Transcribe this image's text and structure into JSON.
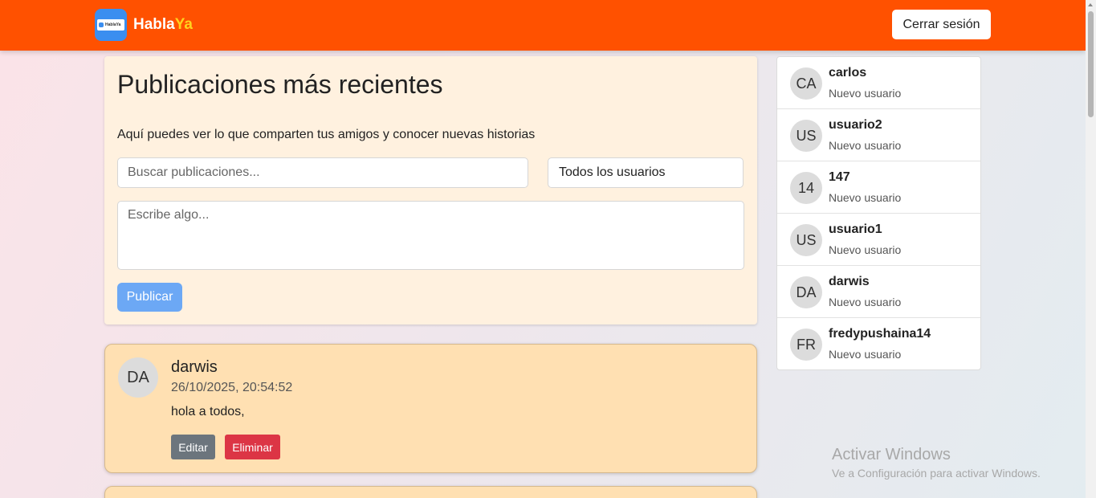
{
  "brand": {
    "logo_text": "HablaYa",
    "name_main": "Habla",
    "name_accent": "Ya"
  },
  "navbar": {
    "logout_label": "Cerrar sesión"
  },
  "composer": {
    "title": "Publicaciones más recientes",
    "subtitle": "Aquí puedes ver lo que comparten tus amigos y conocer nuevas historias",
    "search_placeholder": "Buscar publicaciones...",
    "user_filter_value": "Todos los usuarios",
    "textarea_placeholder": "Escribe algo...",
    "publish_label": "Publicar"
  },
  "posts": [
    {
      "initials": "DA",
      "author": "darwis",
      "timestamp": "26/10/2025, 20:54:52",
      "text": "hola a todos,",
      "edit_label": "Editar",
      "delete_label": "Eliminar"
    }
  ],
  "users": [
    {
      "initials": "CA",
      "name": "carlos",
      "status": "Nuevo usuario"
    },
    {
      "initials": "US",
      "name": "usuario2",
      "status": "Nuevo usuario"
    },
    {
      "initials": "14",
      "name": "147",
      "status": "Nuevo usuario"
    },
    {
      "initials": "US",
      "name": "usuario1",
      "status": "Nuevo usuario"
    },
    {
      "initials": "DA",
      "name": "darwis",
      "status": "Nuevo usuario"
    },
    {
      "initials": "FR",
      "name": "fredypushaina14",
      "status": "Nuevo usuario"
    }
  ],
  "watermark": {
    "title": "Activar Windows",
    "subtitle": "Ve a Configuración para activar Windows."
  },
  "colors": {
    "navbar": "#ff5100",
    "brand_accent": "#ffd21e",
    "publish_button": "#6ca8f5",
    "post_card": "#ffe0b2",
    "edit_button": "#6c757d",
    "delete_button": "#dc3545"
  }
}
